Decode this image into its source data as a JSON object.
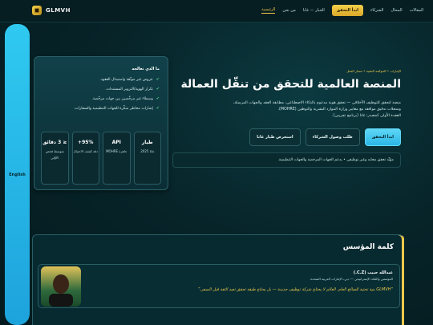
{
  "brand": {
    "name": "GLMVH"
  },
  "nav": {
    "items": [
      "الرئيسية",
      "من نحن",
      "الخبار — غانا",
      "الشركاء",
      "المحال",
      "المقالات"
    ],
    "cta": "ابدأ التحقق"
  },
  "sidebar": {
    "lang": "English"
  },
  "hero": {
    "breadcrumb": "الإمارات • الحوكمة التقنية • مسار العمل",
    "title": "المنصة العالمية للتحقق من تنقّل العمالة",
    "desc1": "منصة لتحقق للتوظيف الأخلاقي — تحقق هوية مدعوم بالذكاء الاصطناعي، مطابقة العقد والجهات المرسلة،",
    "desc2": "وسجلات تدقيق موافقة مع معايير وزارة الموارد البشرية والتوطين (MOHRE).",
    "desc3": "العقدة الأولى كمصدر: غانا (برنامج تجريبي).",
    "buttons": {
      "start": "ابدأ التحقق",
      "partner": "طلب وصول الشركاء",
      "pilot": "استعرض طيار غانا"
    },
    "note": "مؤيِّد تحقق محايد وغير توظيفي • يدعم الجهات المرخصة والجهات التنظيمية."
  },
  "panel": {
    "title": "ما الذي تعالجه",
    "items": [
      "عروض غير موثّقة واستبدال العقود.",
      "تكرار الهوية/التزوير المستندات.",
      "وسطاء غير مرخَّصين بين جهات مرخّصة.",
      "إشارات مخاطر مبكّرة للجهات التنظيمية والسفارات."
    ],
    "stats": [
      {
        "value": "≤ 3 دقائق",
        "label": "متوسط فحص الأوّلي"
      },
      {
        "value": "95%+",
        "label": "دقة كشف الاحتيال"
      },
      {
        "value": "API",
        "label": "جاهزة MOHRE"
      },
      {
        "value": "طيار",
        "label": "غانا 2025"
      }
    ]
  },
  "founder": {
    "section_title": "كلمة المؤسس",
    "name": "عبدالله حبيب (C.Z.)",
    "role": "المؤسس والقائد الإستراتيجي — دبي، الإمارات العربية المتحدة",
    "quote": "“GLMVH بنية تحتية للصالح العام. العالم لا يحتاج شركة توظيف جديدة — بل يحتاج طبقة تحقق تعيد الثقة قبل السفر.”"
  }
}
